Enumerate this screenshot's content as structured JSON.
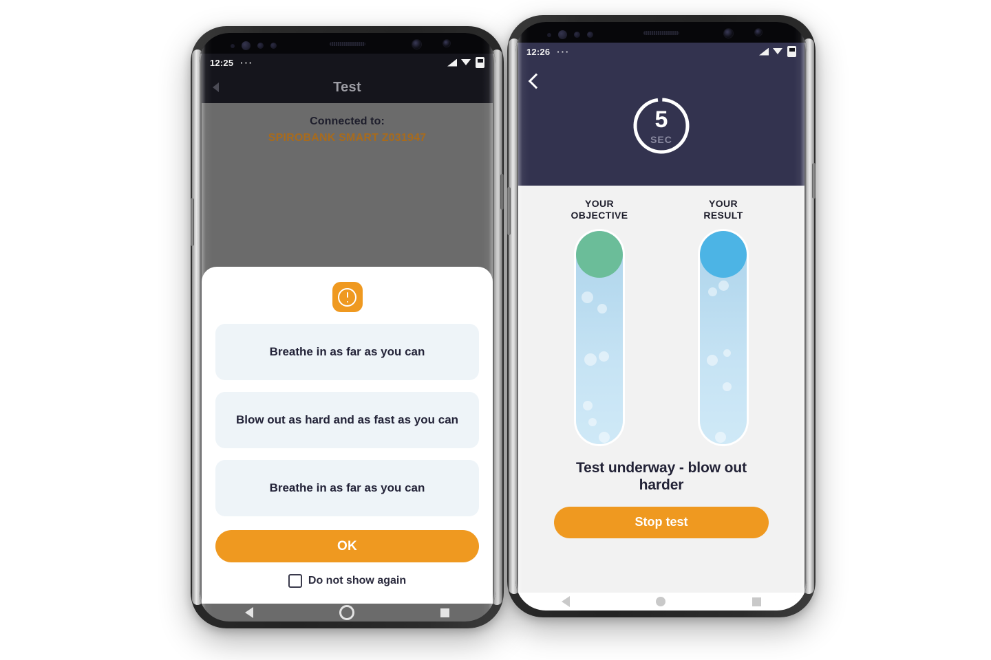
{
  "left_phone": {
    "status_bar": {
      "time": "12:25",
      "dots": "···",
      "icons": [
        "signal-icon",
        "wifi-icon",
        "battery-icon"
      ]
    },
    "title_bar": {
      "title": "Test",
      "back_icon": "back-arrow-icon"
    },
    "connection": {
      "label": "Connected to:",
      "device": "SPIROBANK SMART Z031947"
    },
    "dialog": {
      "icon": "warning-exclamation-icon",
      "steps": [
        "Breathe in as far as you can",
        "Blow out as hard and as fast as you can",
        "Breathe in as far as you can"
      ],
      "confirm_label": "OK",
      "checkbox_label": "Do not show again",
      "checkbox_checked": false
    },
    "nav_bar": {
      "back": "nav-back-icon",
      "home": "nav-home-icon",
      "recents": "nav-recents-icon"
    }
  },
  "right_phone": {
    "status_bar": {
      "time": "12:26",
      "dots": "···",
      "icons": [
        "signal-icon",
        "wifi-icon",
        "battery-icon"
      ]
    },
    "header": {
      "back_icon": "back-chevron-icon",
      "timer_value": "5",
      "timer_unit": "SEC",
      "timer_progress_percent": 97
    },
    "gauges": [
      {
        "label_line1": "YOUR",
        "label_line2": "OBJECTIVE",
        "cap_color": "#6bbd99",
        "fill_level_percent": 100
      },
      {
        "label_line1": "YOUR",
        "label_line2": "RESULT",
        "cap_color": "#4cb4e5",
        "fill_level_percent": 100
      }
    ],
    "status_message": "Test underway - blow out harder",
    "stop_label": "Stop test",
    "nav_bar": {
      "back": "nav-back-icon",
      "home": "nav-home-icon",
      "recents": "nav-recents-icon"
    }
  },
  "colors": {
    "accent_orange": "#ef9920",
    "navy": "#33334f",
    "device_name_orange": "#a86b1c",
    "scrim_gray": "#6b6b6b",
    "step_bg": "#eef4f8"
  }
}
